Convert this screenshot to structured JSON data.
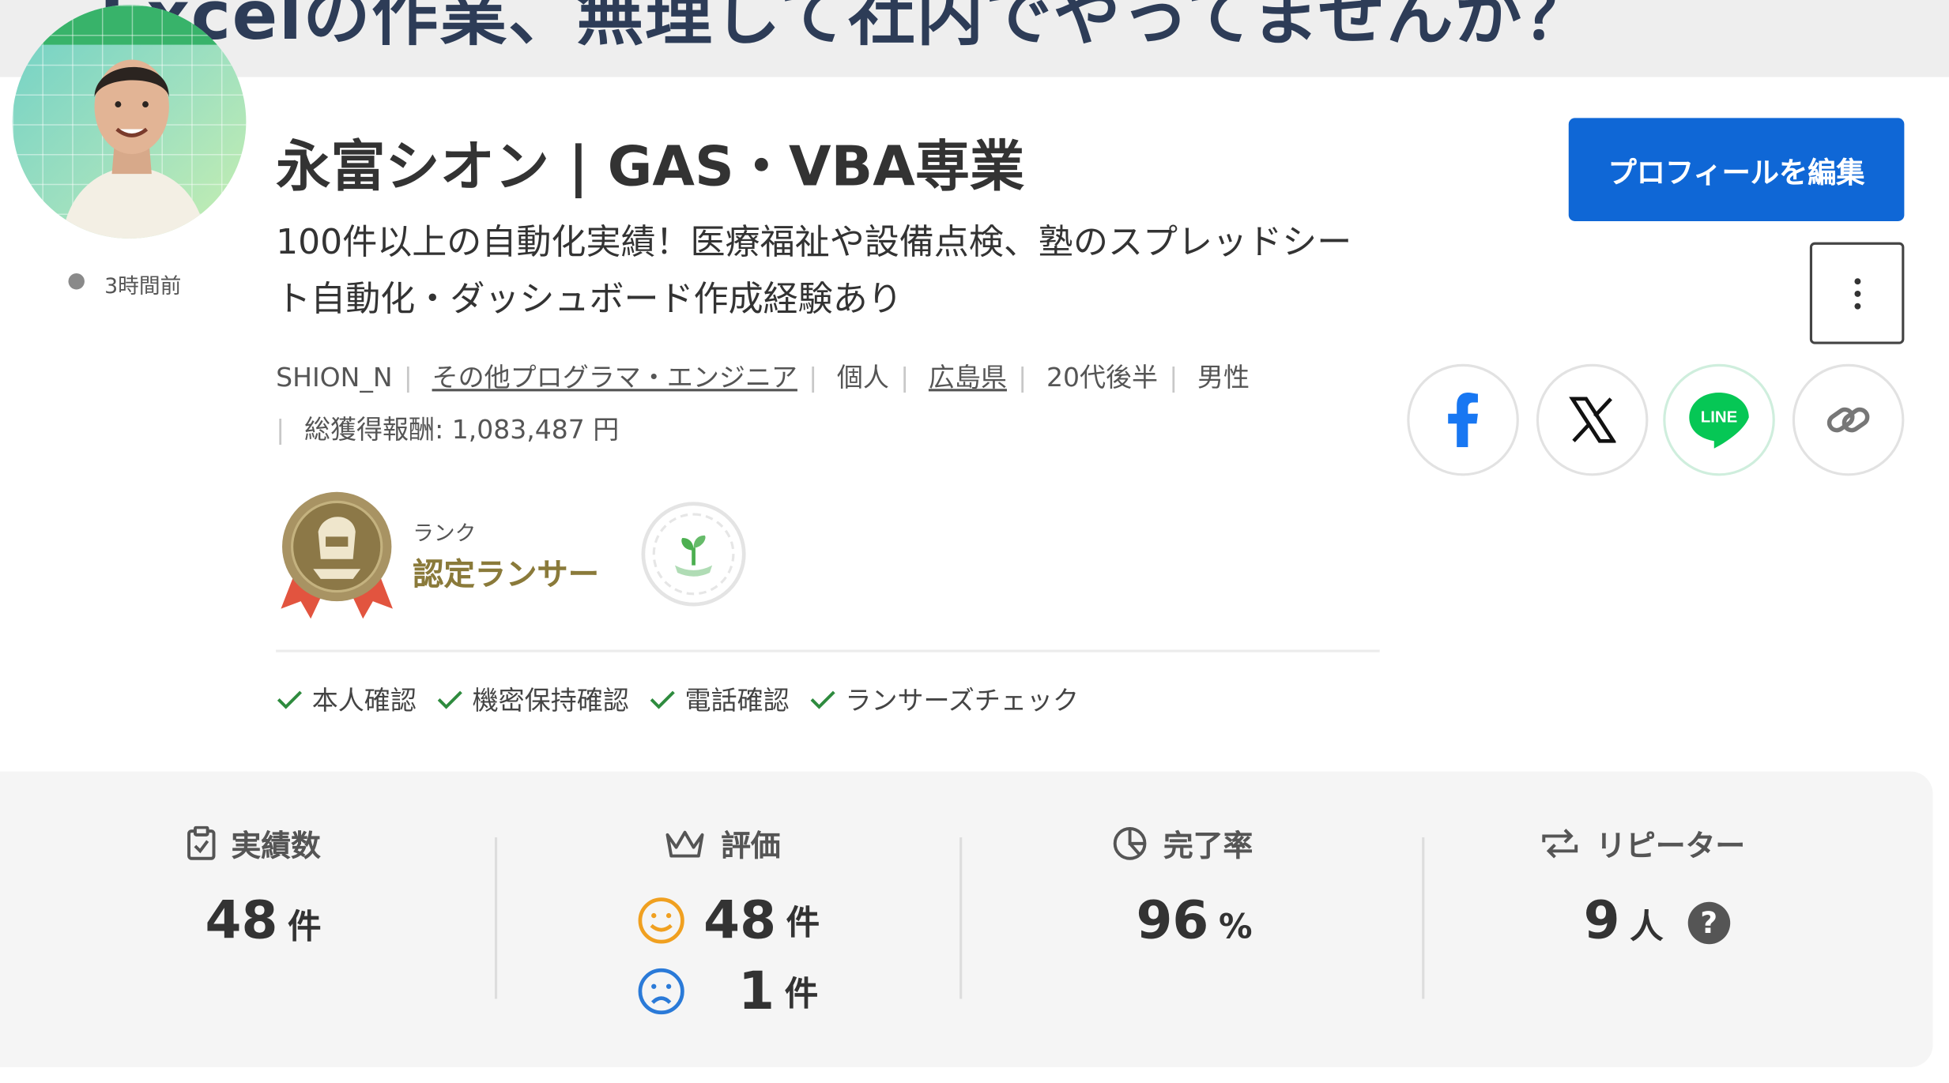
{
  "banner": {
    "text": "Excelの作業、無理して社内でやってませんか？"
  },
  "profile": {
    "name": "永富シオン | GAS・VBA専業",
    "catchphrase": "100件以上の自動化実績！医療福祉や設備点検、塾のスプレッドシート自動化・ダッシュボード作成経験あり",
    "last_active": "3時間前",
    "username": "SHION_N",
    "occupation": "その他プログラマ・エンジニア",
    "type": "個人",
    "location": "広島県",
    "age": "20代後半",
    "gender": "男性",
    "total_earnings": "総獲得報酬: 1,083,487 円"
  },
  "rank": {
    "label": "ランク",
    "name": "認定ランサー"
  },
  "verifications": [
    "本人確認",
    "機密保持確認",
    "電話確認",
    "ランサーズチェック"
  ],
  "actions": {
    "edit_profile": "プロフィールを編集"
  },
  "share": {
    "line_label": "LINE"
  },
  "stats": {
    "achievements": {
      "label": "実績数",
      "value": "48",
      "unit": "件"
    },
    "rating": {
      "label": "評価",
      "good": "48",
      "good_unit": "件",
      "bad": "1",
      "bad_unit": "件"
    },
    "completion": {
      "label": "完了率",
      "value": "96",
      "unit": "%"
    },
    "repeaters": {
      "label": "リピーター",
      "value": "9",
      "unit": "人",
      "help": "?"
    }
  },
  "colors": {
    "primary": "#0f67d6",
    "line_green": "#06c755",
    "facebook": "#1877f2",
    "check": "#2e8b3e",
    "smile": "#f0a020",
    "sad": "#2a7ad8"
  }
}
